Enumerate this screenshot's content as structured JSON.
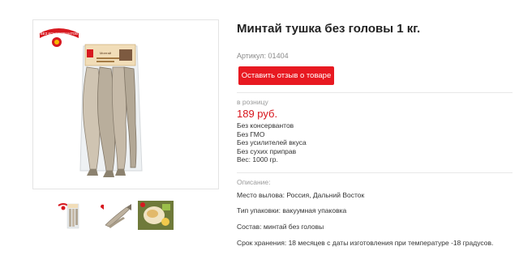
{
  "product": {
    "title": "Минтай тушка без головы 1 кг.",
    "sku_label": "Артикул: 01404",
    "review_button": "Оставить отзыв о товаре",
    "retail_label": "в розницу",
    "price": "189 руб.",
    "features": [
      "Без консервантов",
      "Без ГМО",
      "Без усилителей вкуса",
      "Без сухих приправ",
      "Вес: 1000 гр."
    ],
    "description_label": "Описание:",
    "properties": [
      "Место вылова: Россия, Дальний Восток",
      "Тип упаковки: вакуумная упаковка",
      "Состав: минтай без головы",
      "Срок хранения: 18 месяцев с даты изготовления при температуре -18 градусов."
    ]
  },
  "gallery": {
    "badge_text": "БЕЗ КОНСЕРВАНТОВ",
    "package_label": "Минтай",
    "thumbnails": [
      "product-photo-thumb",
      "fish-photo-thumb",
      "dish-photo-thumb"
    ]
  },
  "colors": {
    "accent_red": "#e81921",
    "price_red": "#d7141b",
    "muted_text": "#9a9a9a"
  }
}
